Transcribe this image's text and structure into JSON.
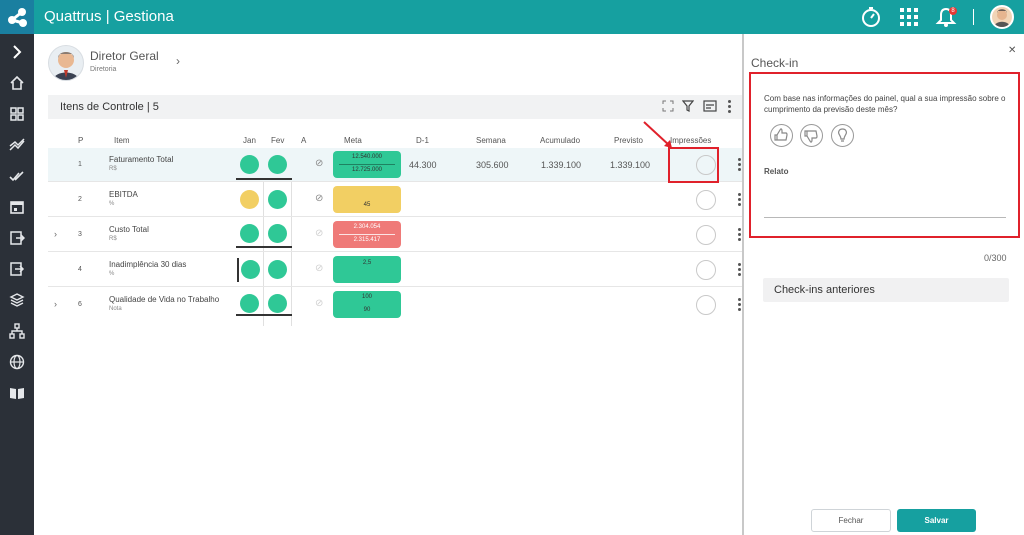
{
  "app": {
    "title": "Quattrus | Gestiona",
    "notification_count": "8"
  },
  "profile": {
    "name": "Diretor Geral",
    "subtitle": "Diretoria"
  },
  "panel": {
    "title": "Itens de Controle | 5"
  },
  "columns": [
    "P",
    "Item",
    "Jan",
    "Fev",
    "A",
    "Meta",
    "D-1",
    "Semana",
    "Acumulado",
    "Previsto",
    "Impressões"
  ],
  "rows": [
    {
      "p": "1",
      "name": "Faturamento Total",
      "unit": "R$",
      "jan": "green",
      "fev": "green",
      "meta_top": "12.540.000",
      "meta_bottom": "12.725.000",
      "meta_color": "green",
      "d1": "44.300",
      "semana": "305.600",
      "acumulado": "1.339.100",
      "previsto": "1.339.100"
    },
    {
      "p": "2",
      "name": "EBITDA",
      "unit": "%",
      "jan": "yellow",
      "fev": "green",
      "meta_single": "45",
      "meta_color": "yellow"
    },
    {
      "p": "3",
      "name": "Custo Total",
      "unit": "R$",
      "jan": "green",
      "fev": "green",
      "meta_top": "2.304.054",
      "meta_bottom": "2.315.417",
      "meta_color": "red"
    },
    {
      "p": "4",
      "name": "Inadimplência 30 dias",
      "unit": "%",
      "jan": "green",
      "fev": "green",
      "meta_single": "2,5",
      "meta_color": "green"
    },
    {
      "p": "6",
      "name": "Qualidade de Vida no Trabalho",
      "unit": "Nota",
      "jan": "green",
      "fev": "green",
      "meta_top": "100",
      "meta_bottom": "90",
      "meta_color": "green"
    }
  ],
  "checkin": {
    "title": "Check-in",
    "question": "Com base nas informações do painel, qual a sua impressão sobre o cumprimento da previsão deste mês?",
    "relato_label": "Relato",
    "counter": "0/300",
    "previous_label": "Check-ins anteriores",
    "close_label": "Fechar",
    "save_label": "Salvar"
  },
  "colors": {
    "teal": "#16a0a0",
    "green": "#2fc896",
    "yellow": "#f2cf63",
    "red": "#ef7a78",
    "highlight": "#e0212b"
  }
}
